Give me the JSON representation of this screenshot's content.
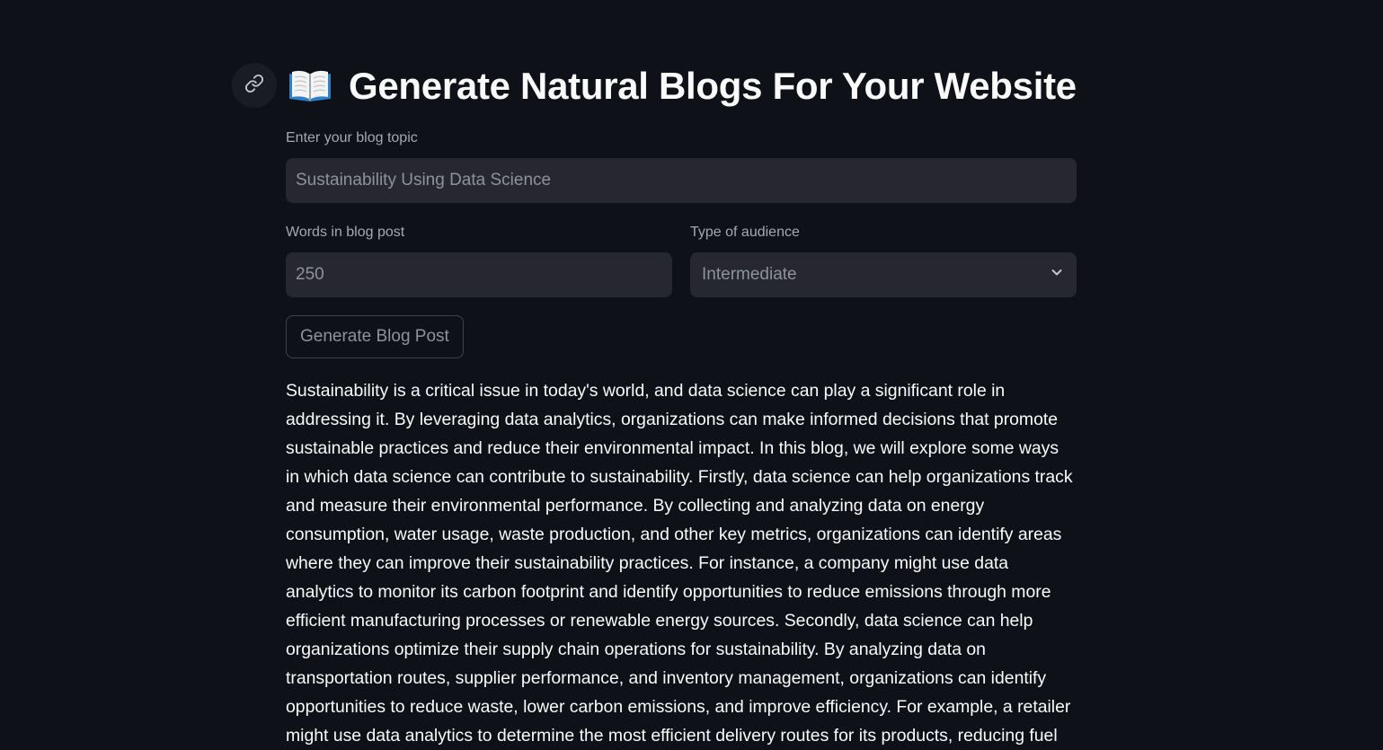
{
  "header": {
    "title": "Generate Natural Blogs For Your Website",
    "title_icon": "open-book-icon",
    "anchor_icon": "link-icon"
  },
  "form": {
    "topic": {
      "label": "Enter your blog topic",
      "value": "Sustainability Using Data Science"
    },
    "words": {
      "label": "Words in blog post",
      "value": "250"
    },
    "audience": {
      "label": "Type of audience",
      "selected": "Intermediate",
      "icon": "chevron-down-icon"
    },
    "generate_label": "Generate Blog Post"
  },
  "output": {
    "text": "Sustainability is a critical issue in today's world, and data science can play a significant role in addressing it. By leveraging data analytics, organizations can make informed decisions that promote sustainable practices and reduce their environmental impact. In this blog, we will explore some ways in which data science can contribute to sustainability. Firstly, data science can help organizations track and measure their environmental performance. By collecting and analyzing data on energy consumption, water usage, waste production, and other key metrics, organizations can identify areas where they can improve their sustainability practices. For instance, a company might use data analytics to monitor its carbon footprint and identify opportunities to reduce emissions through more efficient manufacturing processes or renewable energy sources. Secondly, data science can help organizations optimize their supply chain operations for sustainability. By analyzing data on transportation routes, supplier performance, and inventory management, organizations can identify opportunities to reduce waste, lower carbon emissions, and improve efficiency. For example, a retailer might use data analytics to determine the most efficient delivery routes for its products, reducing fuel consumption and greenhouse gas emissions."
  },
  "colors": {
    "background": "#0e1117",
    "input_background": "#262730",
    "text": "#fafafa",
    "muted": "#a3a8b4"
  }
}
